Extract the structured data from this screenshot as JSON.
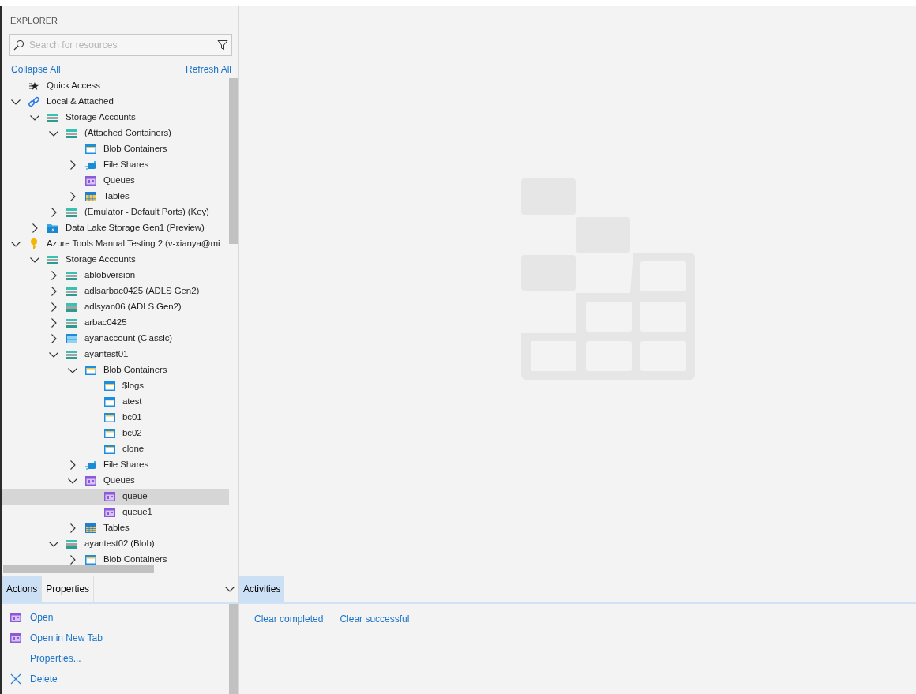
{
  "explorer": {
    "title": "EXPLORER",
    "search": {
      "placeholder": "Search for resources"
    },
    "collapse_all": "Collapse All",
    "refresh_all": "Refresh All"
  },
  "tree": {
    "items": [
      {
        "label": "Quick Access",
        "kind": "quick",
        "selected": false
      },
      {
        "label": "Local & Attached",
        "kind": "link",
        "expanded": true,
        "selected": false,
        "children": [
          {
            "label": "Storage Accounts",
            "kind": "storage",
            "expanded": true,
            "selected": false,
            "children": [
              {
                "label": "(Attached Containers)",
                "kind": "storage",
                "expanded": true,
                "selected": false,
                "children": [
                  {
                    "label": "Blob Containers",
                    "kind": "blob",
                    "selected": false
                  },
                  {
                    "label": "File Shares",
                    "kind": "fileshare",
                    "expanded": false,
                    "selected": false
                  },
                  {
                    "label": "Queues",
                    "kind": "queue",
                    "selected": false
                  },
                  {
                    "label": "Tables",
                    "kind": "table",
                    "expanded": false,
                    "selected": false
                  }
                ]
              },
              {
                "label": "(Emulator - Default Ports) (Key)",
                "kind": "storage",
                "expanded": false,
                "selected": false
              }
            ]
          },
          {
            "label": "Data Lake Storage Gen1 (Preview)",
            "kind": "datalake",
            "expanded": false,
            "selected": false
          }
        ]
      },
      {
        "label": "Azure Tools Manual Testing 2 (v-xianya@mi",
        "kind": "key",
        "expanded": true,
        "selected": false,
        "children": [
          {
            "label": "Storage Accounts",
            "kind": "storage",
            "expanded": true,
            "selected": false,
            "children": [
              {
                "label": "ablobversion",
                "kind": "storage",
                "expanded": false,
                "selected": false
              },
              {
                "label": "adlsarbac0425 (ADLS Gen2)",
                "kind": "storage",
                "expanded": false,
                "selected": false
              },
              {
                "label": "adlsyan06 (ADLS Gen2)",
                "kind": "storage",
                "expanded": false,
                "selected": false
              },
              {
                "label": "arbac0425",
                "kind": "storage",
                "expanded": false,
                "selected": false
              },
              {
                "label": "ayanaccount (Classic)",
                "kind": "classic",
                "expanded": false,
                "selected": false
              },
              {
                "label": "ayantest01",
                "kind": "storage",
                "expanded": true,
                "selected": false,
                "children": [
                  {
                    "label": "Blob Containers",
                    "kind": "blob",
                    "expanded": true,
                    "selected": false,
                    "children": [
                      {
                        "label": "$logs",
                        "kind": "blob",
                        "selected": false
                      },
                      {
                        "label": "atest",
                        "kind": "blob",
                        "selected": false
                      },
                      {
                        "label": "bc01",
                        "kind": "blob",
                        "selected": false
                      },
                      {
                        "label": "bc02",
                        "kind": "blob",
                        "selected": false
                      },
                      {
                        "label": "clone",
                        "kind": "blob",
                        "selected": false
                      }
                    ]
                  },
                  {
                    "label": "File Shares",
                    "kind": "fileshare",
                    "expanded": false,
                    "selected": false
                  },
                  {
                    "label": "Queues",
                    "kind": "queue",
                    "expanded": true,
                    "selected": false,
                    "children": [
                      {
                        "label": "queue",
                        "kind": "queue",
                        "selected": true
                      },
                      {
                        "label": "queue1",
                        "kind": "queue",
                        "selected": false
                      }
                    ]
                  },
                  {
                    "label": "Tables",
                    "kind": "table",
                    "expanded": false,
                    "selected": false
                  }
                ]
              },
              {
                "label": "ayantest02 (Blob)",
                "kind": "storage",
                "expanded": true,
                "selected": false,
                "children": [
                  {
                    "label": "Blob Containers",
                    "kind": "blob",
                    "expanded": false,
                    "selected": false
                  }
                ]
              }
            ]
          }
        ]
      }
    ]
  },
  "actions_panel": {
    "tabs": [
      {
        "label": "Actions",
        "selected": true
      },
      {
        "label": "Properties",
        "selected": false
      }
    ],
    "actions": [
      {
        "label": "Open",
        "kind": "queue"
      },
      {
        "label": "Open in New Tab",
        "kind": "queue"
      },
      {
        "label": "Properties...",
        "kind": "plain"
      },
      {
        "label": "Delete",
        "kind": "delete"
      }
    ]
  },
  "activities_panel": {
    "tabs": [
      {
        "label": "Activities",
        "selected": true
      }
    ],
    "links": [
      "Clear completed",
      "Clear successful"
    ]
  }
}
